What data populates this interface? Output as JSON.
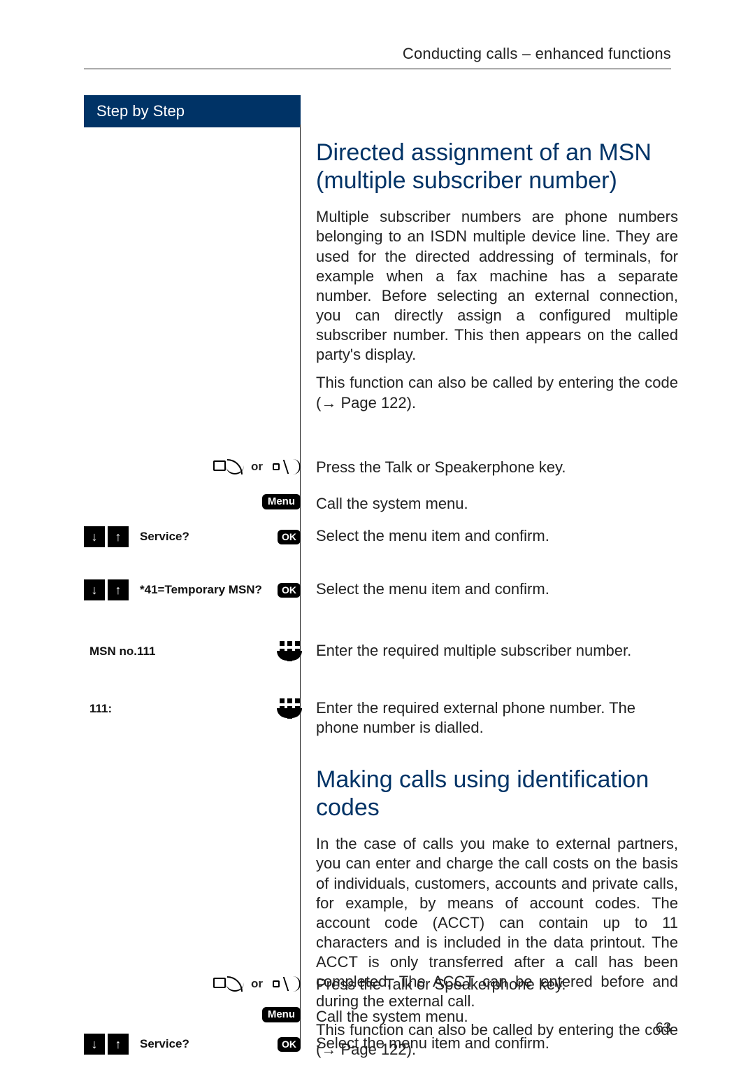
{
  "header": {
    "running_head": "Conducting calls – enhanced functions"
  },
  "sidebar": {
    "title": "Step by Step"
  },
  "labels": {
    "or": "or",
    "menu": "Menu",
    "ok": "OK",
    "page_ref_prefix": "(",
    "page_ref_link": "Page 122",
    "page_ref_suffix": ")."
  },
  "section1": {
    "heading": "Directed assignment of an MSN (multiple subscriber number)",
    "p1": "Multiple subscriber numbers are phone numbers belonging to an ISDN multiple device line. They are used for the directed addressing of terminals, for example when a fax machine has a separate number. Before selecting an external connection, you can directly assign a configured multiple subscriber number. This then appears on the called party's display.",
    "p2": "This function can also be called by entering the code",
    "steps": {
      "talk": "Press the Talk or Speakerphone key.",
      "menu": "Call the system menu.",
      "service_label": "Service?",
      "service_text": "Select the menu item and confirm.",
      "tempmsn_label": "*41=Temporary MSN?",
      "tempmsn_text": "Select the menu item and confirm.",
      "msnno_label": "MSN no.111",
      "msnno_text": "Enter the required multiple subscriber number.",
      "dial_label": "111:",
      "dial_text": "Enter the required external phone number. The phone number is dialled."
    }
  },
  "section2": {
    "heading": "Making calls using identification codes",
    "p1": "In the case of calls you make to external partners, you can enter and charge the call costs on the basis of individuals, customers, accounts and private calls, for example, by means of account codes. The account code (ACCT) can contain up to 11 characters and is included in the data printout. The ACCT is only transferred after a call has been completed. The ACCT can be entered before and during the external call.",
    "p2": "This function can also be called by entering the code",
    "steps": {
      "talk": "Press the Talk or Speakerphone key.",
      "menu": "Call the system menu.",
      "service_label": "Service?",
      "service_text": "Select the menu item and confirm."
    }
  },
  "page_number": "63"
}
